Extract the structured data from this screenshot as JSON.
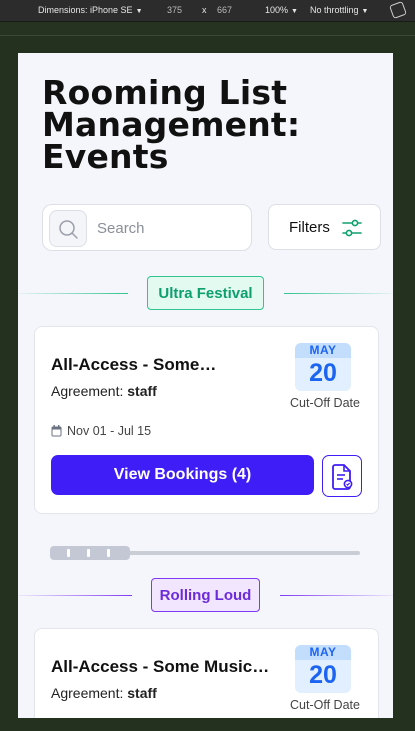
{
  "devtools": {
    "dimensions_label": "Dimensions: iPhone SE",
    "width": "375",
    "times": "x",
    "height": "667",
    "zoom": "100%",
    "throttling": "No throttling"
  },
  "page": {
    "title": "Rooming List Management: Events"
  },
  "search": {
    "placeholder": "Search"
  },
  "filters": {
    "label": "Filters"
  },
  "events": [
    {
      "tag": "Ultra Festival",
      "tag_color": "#0e9f6e",
      "card": {
        "title": "All-Access - Some…",
        "agreement_label": "Agreement:",
        "agreement_value": "staff",
        "month": "MAY",
        "day": "20",
        "cutoff_label": "Cut-Off Date",
        "date_range": "Nov 01 - Jul 15",
        "view_label": "View Bookings (4)"
      }
    },
    {
      "tag": "Rolling Loud",
      "tag_color": "#6c2bd9",
      "card": {
        "title": "All-Access - Some Music…",
        "agreement_label": "Agreement:",
        "agreement_value": "staff",
        "month": "MAY",
        "day": "20",
        "cutoff_label": "Cut-Off Date"
      }
    }
  ],
  "colors": {
    "primary": "#3f1df6",
    "calendar": "#1c64f2"
  }
}
